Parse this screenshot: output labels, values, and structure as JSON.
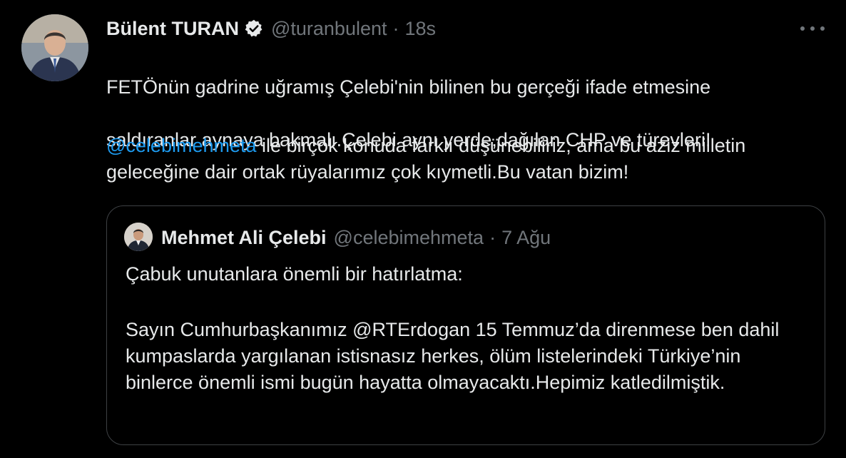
{
  "tweet": {
    "author_name": "Bülent TURAN",
    "author_handle": "@turanbulent",
    "separator": "·",
    "time": "18s",
    "text_line1": "FETÖnün gadrine uğramış Çelebi'nin bilinen  bu gerçeği ifade etmesine",
    "text_line2": "saldıranlar aynaya bakmalı.Çelebi aynı yerde,dağılan CHP ve türevleri!",
    "mention": "@celebimehmeta",
    "text_after_mention": " ile birçok konuda farklı düşünebiliriz; ama bu aziz milletin geleceğine dair ortak rüyalarımız çok kıymetli.Bu vatan bizim!"
  },
  "quoted_tweet": {
    "author_name": "Mehmet Ali Çelebi",
    "author_handle": "@celebimehmeta",
    "separator": "·",
    "date": "7 Ağu",
    "text_para1": "Çabuk unutanlara önemli bir hatırlatma:",
    "text_para2": "Sayın Cumhurbaşkanımız @RTErdogan 15 Temmuz’da direnmese ben dahil kumpaslarda yargılanan istisnasız herkes, ölüm listelerindeki Türkiye’nin binlerce önemli ismi bugün hayatta olmayacaktı.Hepimiz katledilmiştik."
  },
  "icons": {
    "verified": "verified-badge-icon",
    "more": "more-options-icon"
  },
  "colors": {
    "background": "#000000",
    "text": "#e7e9ea",
    "muted": "#71767b",
    "link": "#1d9bf0",
    "border": "#3e4144"
  }
}
